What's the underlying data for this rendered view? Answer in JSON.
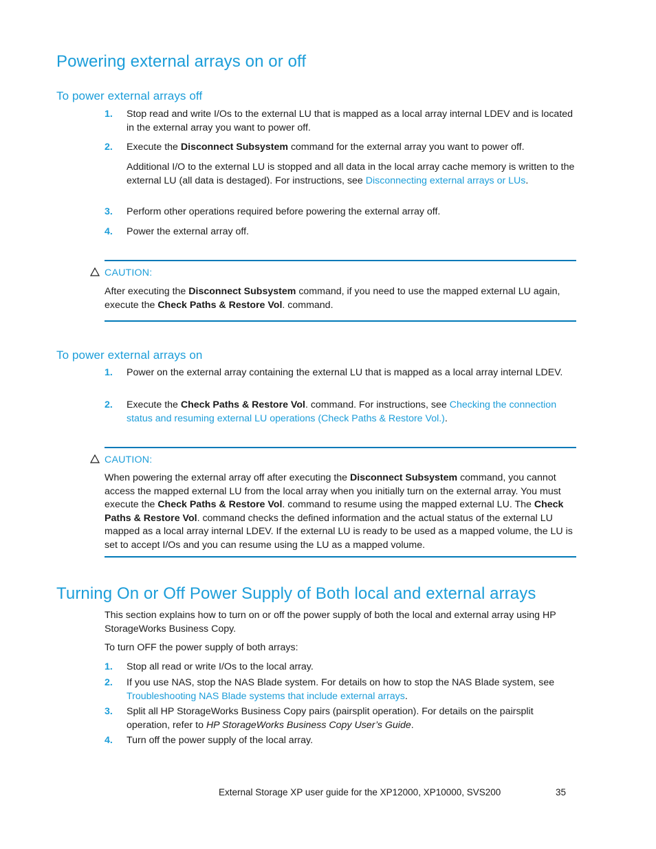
{
  "section1": {
    "heading": "Powering external arrays on or off",
    "sub1": {
      "heading": "To power external arrays off",
      "items": [
        {
          "num": "1.",
          "text_a": "Stop read and write I/Os to the external LU that is mapped as a local array internal LDEV and is located in the external array you want to power off."
        },
        {
          "num": "2.",
          "text_a": "Execute the ",
          "bold_a": "Disconnect Subsystem",
          "text_b": " command for the external array you want to power off.",
          "cont_a": "Additional I/O to the external LU is stopped and all data in the local array cache memory is written to the external LU (all data is destaged). For instructions, see ",
          "cont_link": "Disconnecting external arrays or LUs",
          "cont_b": "."
        },
        {
          "num": "3.",
          "text_a": "Perform other operations required before powering the external array off."
        },
        {
          "num": "4.",
          "text_a": "Power the external array off."
        }
      ]
    },
    "caution1": {
      "label": "CAUTION:",
      "text_a": "After executing the ",
      "bold_a": "Disconnect Subsystem",
      "text_b": " command, if you need to use the mapped external LU again, execute the ",
      "bold_b": "Check Paths & Restore Vol",
      "text_c": ". command."
    },
    "sub2": {
      "heading": "To power external arrays on",
      "items": [
        {
          "num": "1.",
          "text_a": "Power on the external array containing the external LU that is mapped as a local array internal LDEV."
        },
        {
          "num": "2.",
          "text_a": "Execute the ",
          "bold_a": "Check Paths & Restore Vol",
          "text_b": ". command. For instructions, see ",
          "link": "Checking the connection status and resuming external LU operations (Check Paths & Restore Vol.)",
          "text_c": "."
        }
      ]
    },
    "caution2": {
      "label": "CAUTION:",
      "text_a": "When powering the external array off after executing the ",
      "bold_a": "Disconnect Subsystem",
      "text_b": " command, you cannot access the mapped external LU from the local array when you initially turn on the external array. You must execute the ",
      "bold_b": "Check Paths & Restore Vol",
      "text_c": ". command to resume using the mapped external LU. The ",
      "bold_c": "Check Paths & Restore Vol",
      "text_d": ". command checks the defined information and the actual status of the external LU mapped as a local array internal LDEV. If the external LU is ready to be used as a mapped volume, the LU is set to accept I/Os and you can resume using the LU as a mapped volume."
    }
  },
  "section2": {
    "heading": "Turning On or Off Power Supply of Both local and external arrays",
    "intro": "This section explains how to turn on or off the power supply of both the local and external array using HP StorageWorks Business Copy.",
    "lead": "To turn OFF the power supply of both arrays:",
    "items": [
      {
        "num": "1.",
        "text_a": "Stop all read or write I/Os to the local array."
      },
      {
        "num": "2.",
        "text_a": "If you use NAS, stop the NAS Blade system. For details on how to stop the NAS Blade system, see ",
        "link": "Troubleshooting NAS Blade systems that include external arrays",
        "text_b": "."
      },
      {
        "num": "3.",
        "text_a": "Split all HP StorageWorks Business Copy pairs (pairsplit operation). For details on the pairsplit operation, refer to ",
        "italic_a": "HP StorageWorks Business Copy User’s Guide",
        "text_b": "."
      },
      {
        "num": "4.",
        "text_a": "Turn off the power supply of the local array."
      }
    ]
  },
  "footer": {
    "text": "External Storage XP user guide for the XP12000, XP10000, SVS200",
    "page": "35"
  },
  "colors": {
    "heading_blue": "#1b9dd9",
    "rule_blue": "#0079b8",
    "body_black": "#1a1a1a"
  }
}
